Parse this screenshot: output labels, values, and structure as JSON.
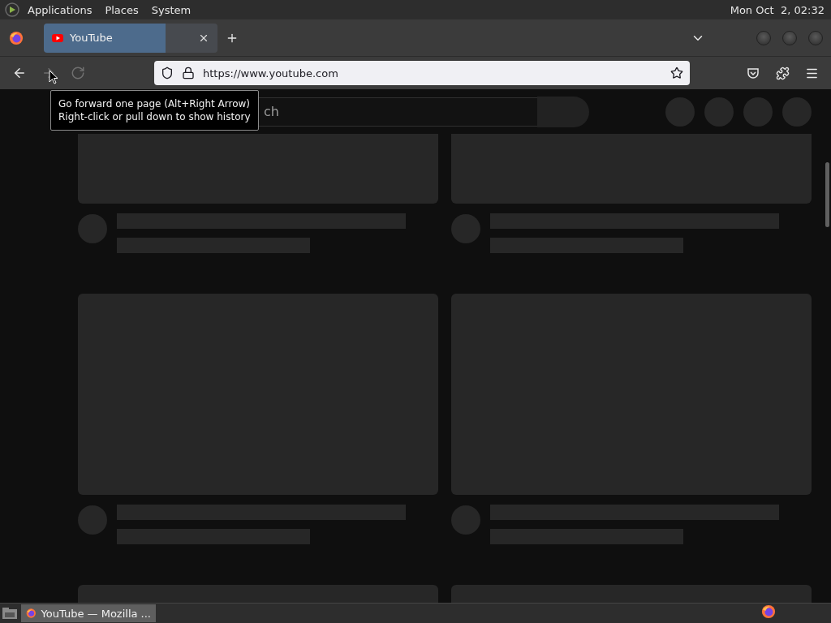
{
  "top_panel": {
    "menus": [
      "Applications",
      "Places",
      "System"
    ],
    "clock": "Mon Oct  2, 02:32"
  },
  "tabs": [
    {
      "label": "YouTube",
      "selected": true
    }
  ],
  "nav_buttons": [
    {
      "kind": "back",
      "disabled": false
    },
    {
      "kind": "forward",
      "disabled": true
    },
    {
      "kind": "reload",
      "disabled": true
    }
  ],
  "url_bar": {
    "url": "https://www.youtube.com"
  },
  "tooltip": {
    "lines": [
      "Go forward one page (Alt+Right Arrow)",
      "Right-click or pull down to show history"
    ]
  },
  "page": {
    "search": {
      "placeholder": "ch"
    }
  },
  "taskbar": {
    "items": [
      {
        "label": "YouTube — Mozilla ...",
        "selected": true
      }
    ]
  }
}
